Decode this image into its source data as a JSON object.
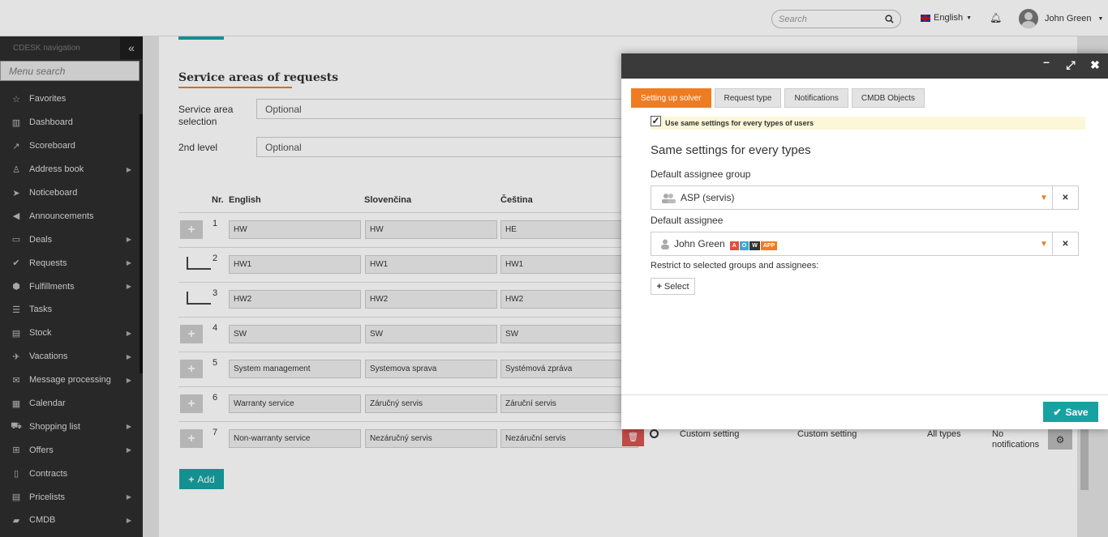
{
  "topbar": {
    "search_placeholder": "Search",
    "language": "English",
    "user_name": "John Green"
  },
  "sidebar": {
    "title": "CDESK navigation",
    "menu_search_placeholder": "Menu search",
    "items": [
      {
        "label": "Favorites",
        "icon": "star-icon",
        "submenu": false
      },
      {
        "label": "Dashboard",
        "icon": "bar-chart-icon",
        "submenu": false
      },
      {
        "label": "Scoreboard",
        "icon": "line-chart-icon",
        "submenu": false
      },
      {
        "label": "Address book",
        "icon": "user-icon",
        "submenu": true
      },
      {
        "label": "Noticeboard",
        "icon": "paper-plane-icon",
        "submenu": false
      },
      {
        "label": "Announcements",
        "icon": "bullhorn-icon",
        "submenu": false
      },
      {
        "label": "Deals",
        "icon": "credit-card-icon",
        "submenu": true
      },
      {
        "label": "Requests",
        "icon": "check-circle-icon",
        "submenu": true
      },
      {
        "label": "Fulfillments",
        "icon": "cube-icon",
        "submenu": true
      },
      {
        "label": "Tasks",
        "icon": "list-icon",
        "submenu": false
      },
      {
        "label": "Stock",
        "icon": "archive-icon",
        "submenu": true
      },
      {
        "label": "Vacations",
        "icon": "plane-icon",
        "submenu": true
      },
      {
        "label": "Message processing",
        "icon": "envelope-icon",
        "submenu": true
      },
      {
        "label": "Calendar",
        "icon": "calendar-icon",
        "submenu": false
      },
      {
        "label": "Shopping list",
        "icon": "cart-icon",
        "submenu": true
      },
      {
        "label": "Offers",
        "icon": "gift-icon",
        "submenu": true
      },
      {
        "label": "Contracts",
        "icon": "file-icon",
        "submenu": false
      },
      {
        "label": "Pricelists",
        "icon": "file-text-icon",
        "submenu": true
      },
      {
        "label": "CMDB",
        "icon": "folder-icon",
        "submenu": true
      }
    ]
  },
  "main": {
    "section_title": "Service areas of requests",
    "service_area_label": "Service area selection",
    "service_area_value": "Optional",
    "second_level_label": "2nd level",
    "second_level_value": "Optional",
    "table_headers": {
      "nr": "Nr.",
      "english": "English",
      "slovak": "Slovenčina",
      "czech": "Čeština"
    },
    "rows": [
      {
        "nr": "1",
        "en": "HW",
        "sk": "HW",
        "cs": "HE",
        "indent": false
      },
      {
        "nr": "2",
        "en": "HW1",
        "sk": "HW1",
        "cs": "HW1",
        "indent": true
      },
      {
        "nr": "3",
        "en": "HW2",
        "sk": "HW2",
        "cs": "HW2",
        "indent": true
      },
      {
        "nr": "4",
        "en": "SW",
        "sk": "SW",
        "cs": "SW",
        "indent": false
      },
      {
        "nr": "5",
        "en": "System management",
        "sk": "Systemova sprava",
        "cs": "Systémová zpráva",
        "indent": false
      },
      {
        "nr": "6",
        "en": "Warranty service",
        "sk": "Záručný servis",
        "cs": "Záruční servis",
        "indent": false
      },
      {
        "nr": "7",
        "en": "Non-warranty service",
        "sk": "Nezáručný servis",
        "cs": "Nezáruční servis",
        "indent": false
      }
    ],
    "row7_extra": {
      "solver": "Custom setting",
      "request_type": "Custom setting",
      "types": "All types",
      "notifications": "No notifications"
    },
    "add_label": "Add"
  },
  "modal": {
    "tabs": [
      "Setting up solver",
      "Request type",
      "Notifications",
      "CMDB Objects"
    ],
    "active_tab": 0,
    "same_settings_checkbox": "Use same settings for every types of users",
    "heading": "Same settings for every types",
    "group_label": "Default assignee group",
    "group_value": "ASP (servis)",
    "assignee_label": "Default assignee",
    "assignee_value": "John Green",
    "assignee_badges": [
      {
        "text": "A",
        "color": "#e74c3c"
      },
      {
        "text": "O",
        "color": "#3fa7d6"
      },
      {
        "text": "W",
        "color": "#333333"
      },
      {
        "text": "APP",
        "color": "#ef7c22"
      }
    ],
    "restrict_label": "Restrict to selected groups and assignees:",
    "select_label": "Select",
    "save_label": "Save"
  },
  "colors": {
    "accent": "#17a2a2",
    "brand_orange": "#ef7c22",
    "sidebar_bg": "#2d2d2d"
  }
}
